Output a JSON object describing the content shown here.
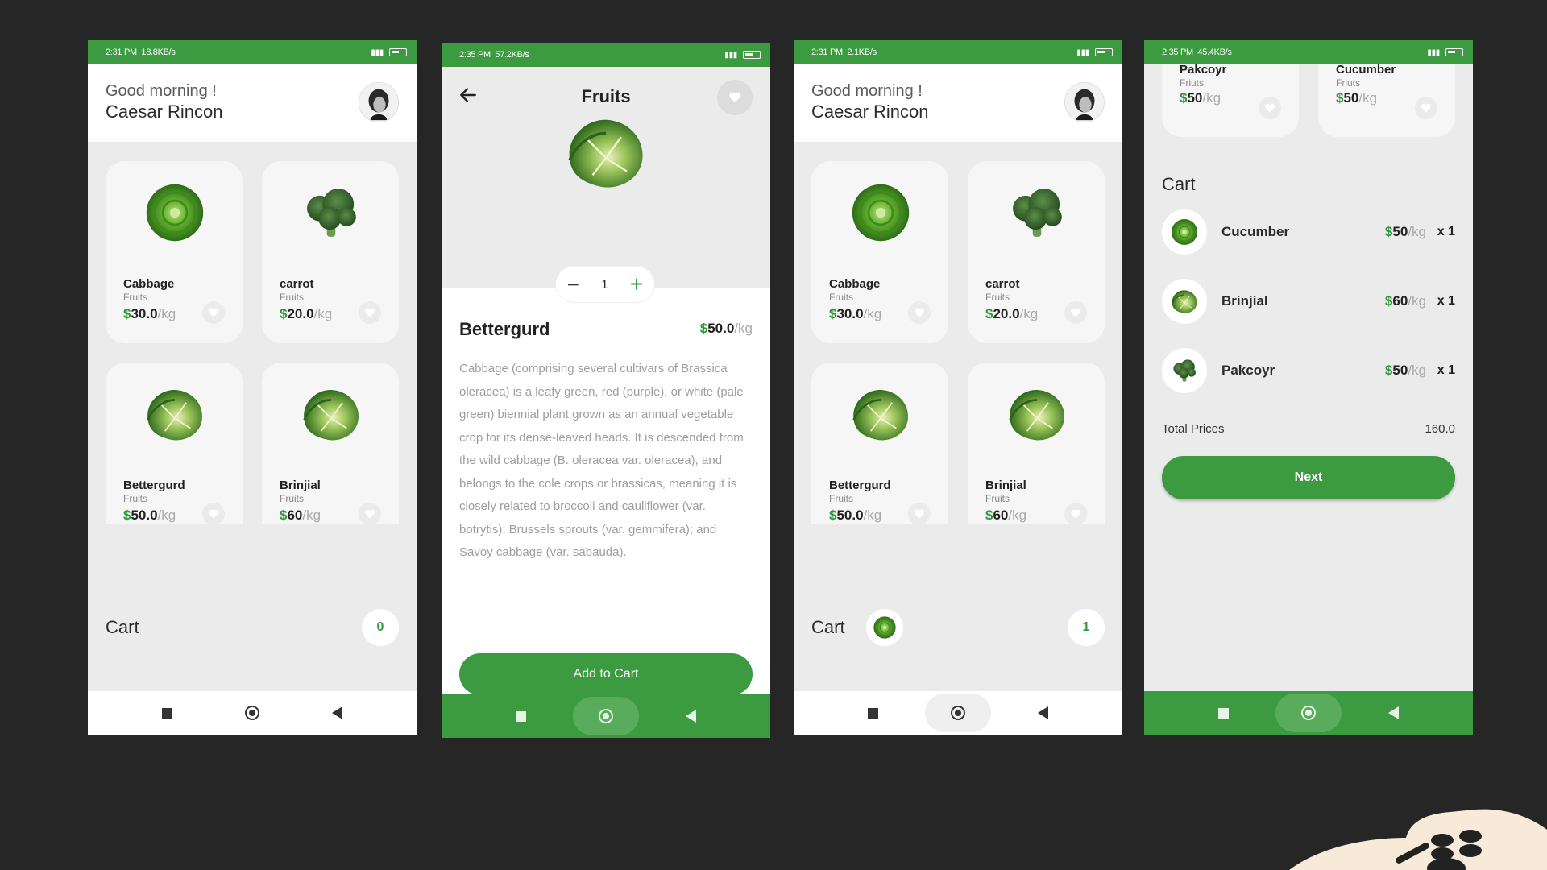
{
  "colors": {
    "accent": "#3c9a41",
    "price_green": "#2e9a3a",
    "background": "#262626",
    "screen_bg": "#ebebeb"
  },
  "home_screen": {
    "status": {
      "time": "2:31 PM",
      "speed": "18.8KB/s"
    },
    "greeting": "Good morning !",
    "user_name": "Caesar Rincon",
    "products": [
      {
        "name": "Cabbage",
        "category": "Fruits",
        "currency": "$",
        "price": "30.0",
        "unit": "/kg",
        "icon": "cabbage-image"
      },
      {
        "name": "carrot",
        "category": "Fruits",
        "currency": "$",
        "price": "20.0",
        "unit": "/kg",
        "icon": "broccoli-image"
      },
      {
        "name": "Bettergurd",
        "category": "Fruits",
        "currency": "$",
        "price": "50.0",
        "unit": "/kg",
        "icon": "savoy-cabbage-image"
      },
      {
        "name": "Brinjial",
        "category": "Fruits",
        "currency": "$",
        "price": "60",
        "unit": "/kg",
        "icon": "savoy-cabbage-image"
      }
    ],
    "cart_label": "Cart",
    "cart_count": "0"
  },
  "detail_screen": {
    "status": {
      "time": "2:35 PM",
      "speed": "57.2KB/s"
    },
    "title": "Fruits",
    "quantity": "1",
    "product_name": "Bettergurd",
    "currency": "$",
    "price": "50.0",
    "unit": "/kg",
    "description": "Cabbage (comprising several cultivars of Brassica oleracea) is a leafy green, red (purple), or white (pale green) biennial plant grown as an annual vegetable crop for its dense-leaved heads. It is descended from the wild cabbage (B. oleracea var. oleracea), and belongs to the cole crops or brassicas, meaning it is closely related to broccoli and cauliflower (var. botrytis); Brussels sprouts (var. gemmifera); and Savoy cabbage (var. sabauda).",
    "add_button": "Add to Cart"
  },
  "home_screen_2": {
    "status": {
      "time": "2:31 PM",
      "speed": "2.1KB/s"
    },
    "greeting": "Good morning !",
    "user_name": "Caesar Rincon",
    "products": [
      {
        "name": "Cabbage",
        "category": "Fruits",
        "currency": "$",
        "price": "30.0",
        "unit": "/kg"
      },
      {
        "name": "carrot",
        "category": "Fruits",
        "currency": "$",
        "price": "20.0",
        "unit": "/kg"
      },
      {
        "name": "Bettergurd",
        "category": "Fruits",
        "currency": "$",
        "price": "50.0",
        "unit": "/kg"
      },
      {
        "name": "Brinjial",
        "category": "Fruits",
        "currency": "$",
        "price": "60",
        "unit": "/kg"
      }
    ],
    "cart_label": "Cart",
    "cart_count": "1"
  },
  "cart_screen": {
    "status": {
      "time": "2:35 PM",
      "speed": "45.4KB/s"
    },
    "top_products": [
      {
        "name": "Pakcoyr",
        "category": "Friuts",
        "currency": "$",
        "price": "50",
        "unit": "/kg"
      },
      {
        "name": "Cucumber",
        "category": "Friuts",
        "currency": "$",
        "price": "50",
        "unit": "/kg"
      }
    ],
    "heading": "Cart",
    "items": [
      {
        "name": "Cucumber",
        "currency": "$",
        "price": "50",
        "unit": "/kg",
        "qty": "x 1"
      },
      {
        "name": "Brinjial",
        "currency": "$",
        "price": "60",
        "unit": "/kg",
        "qty": "x 1"
      },
      {
        "name": "Pakcoyr",
        "currency": "$",
        "price": "50",
        "unit": "/kg",
        "qty": "x 1"
      }
    ],
    "total_label": "Total Prices",
    "total_value": "160.0",
    "next_button": "Next"
  }
}
